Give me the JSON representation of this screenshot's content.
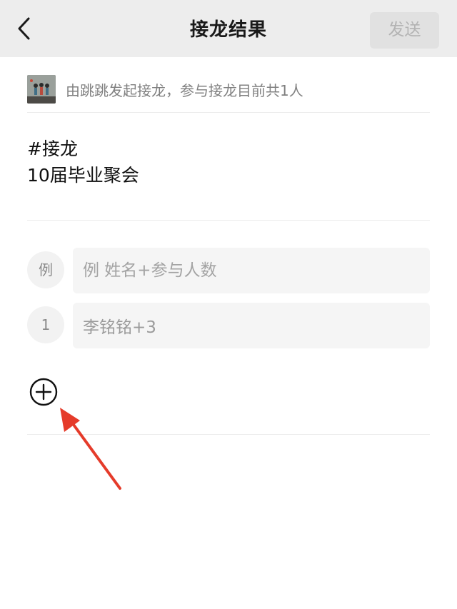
{
  "navbar": {
    "back_icon": "chevron-left-icon",
    "title": "接龙结果",
    "send_label": "发送"
  },
  "creator": {
    "avatar_icon": "avatar-image",
    "text": "由跳跳发起接龙，参与接龙目前共1人"
  },
  "description": {
    "line1": "#接龙",
    "line2": "10届毕业聚会"
  },
  "entries": [
    {
      "index": "例",
      "placeholder": "例 姓名+参与人数",
      "value": ""
    },
    {
      "index": "1",
      "placeholder": "",
      "value": "李铭铭+3"
    }
  ],
  "add_button": {
    "icon": "plus-circle-icon"
  },
  "annotation": {
    "color": "#e53b2a"
  }
}
